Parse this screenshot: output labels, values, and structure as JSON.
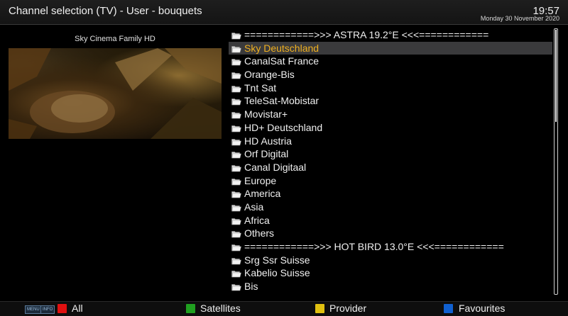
{
  "header": {
    "title": "Channel selection (TV) - User - bouquets",
    "time": "19:57",
    "date": "Monday 30 November 2020"
  },
  "preview": {
    "channel_name": "Sky Cinema Family HD"
  },
  "bouquets": [
    {
      "label": "============>>> ASTRA 19.2°E <<<============"
    },
    {
      "label": "Sky Deutschland"
    },
    {
      "label": "CanalSat France"
    },
    {
      "label": "Orange-Bis"
    },
    {
      "label": "Tnt Sat"
    },
    {
      "label": "TeleSat-Mobistar"
    },
    {
      "label": "Movistar+"
    },
    {
      "label": "HD+ Deutschland"
    },
    {
      "label": "HD Austria"
    },
    {
      "label": "Orf Digital"
    },
    {
      "label": "Canal Digitaal"
    },
    {
      "label": "Europe"
    },
    {
      "label": "America"
    },
    {
      "label": "Asia"
    },
    {
      "label": "Africa"
    },
    {
      "label": "Others"
    },
    {
      "label": "============>>> HOT BIRD 13.0°E <<<============"
    },
    {
      "label": "Srg Ssr Suisse"
    },
    {
      "label": "Kabelio Suisse"
    },
    {
      "label": "Bis"
    }
  ],
  "selected_index": 1,
  "icon": "folder-icon",
  "footer": {
    "menu_key": "MENU",
    "info_key": "INFO",
    "buttons": [
      {
        "label": "All",
        "color": "#e01010"
      },
      {
        "label": "Satellites",
        "color": "#20a020"
      },
      {
        "label": "Provider",
        "color": "#e0c010"
      },
      {
        "label": "Favourites",
        "color": "#1060d0"
      }
    ]
  },
  "colors": {
    "selected_text": "#f0b020",
    "selected_bg": "#3a3a3c"
  }
}
